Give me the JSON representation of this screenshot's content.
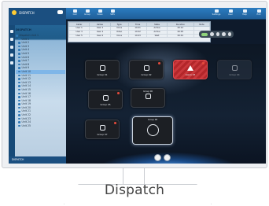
{
  "caption": "Dispatch",
  "app": {
    "title": "DISPATCH",
    "tree_title": "DISPATCH",
    "footer": "DISPATCH"
  },
  "tree_items": [
    {
      "label": "Dispatch Unit 1",
      "selected": false,
      "indent": false
    },
    {
      "label": "Unit 1",
      "selected": false,
      "indent": true
    },
    {
      "label": "Unit 2",
      "selected": false,
      "indent": true
    },
    {
      "label": "Unit 3",
      "selected": false,
      "indent": true
    },
    {
      "label": "Unit 4",
      "selected": false,
      "indent": true
    },
    {
      "label": "Unit 5",
      "selected": false,
      "indent": true
    },
    {
      "label": "Unit 6",
      "selected": false,
      "indent": true
    },
    {
      "label": "Unit 7",
      "selected": false,
      "indent": true
    },
    {
      "label": "Unit 8",
      "selected": false,
      "indent": true
    },
    {
      "label": "Unit 9",
      "selected": false,
      "indent": true
    },
    {
      "label": "Unit 10",
      "selected": true,
      "indent": true
    },
    {
      "label": "Unit 11",
      "selected": false,
      "indent": true
    },
    {
      "label": "Unit 12",
      "selected": false,
      "indent": true
    },
    {
      "label": "Unit 13",
      "selected": false,
      "indent": true
    },
    {
      "label": "Unit 14",
      "selected": false,
      "indent": true
    },
    {
      "label": "Unit 15",
      "selected": false,
      "indent": true
    },
    {
      "label": "Unit 16",
      "selected": false,
      "indent": true
    },
    {
      "label": "Unit 17",
      "selected": false,
      "indent": true
    },
    {
      "label": "Unit 18",
      "selected": false,
      "indent": true
    },
    {
      "label": "Unit 19",
      "selected": false,
      "indent": true
    },
    {
      "label": "Unit 20",
      "selected": false,
      "indent": true
    },
    {
      "label": "Unit 21",
      "selected": false,
      "indent": true
    },
    {
      "label": "Unit 22",
      "selected": false,
      "indent": true
    },
    {
      "label": "Unit 23",
      "selected": false,
      "indent": true
    },
    {
      "label": "Unit 24",
      "selected": false,
      "indent": true
    },
    {
      "label": "Unit 25",
      "selected": false,
      "indent": true
    }
  ],
  "toolbar": {
    "left": [
      {
        "icon": "phone-icon",
        "label": "Call"
      },
      {
        "icon": "group-icon",
        "label": "Group"
      },
      {
        "icon": "video-icon",
        "label": "Video"
      },
      {
        "icon": "message-icon",
        "label": "SMS"
      }
    ],
    "right": [
      {
        "icon": "settings-icon",
        "label": "Settings"
      },
      {
        "icon": "user-icon",
        "label": "User"
      },
      {
        "icon": "help-icon",
        "label": "Help"
      },
      {
        "icon": "exit-icon",
        "label": "Exit"
      }
    ]
  },
  "grid": {
    "headers": [
      "Caller",
      "Callee",
      "Type",
      "Time",
      "State",
      "Duration",
      "Note"
    ],
    "rows": [
      [
        "User 1",
        "User 2",
        "Voice",
        "10:21",
        "Active",
        "00:12",
        ""
      ],
      [
        "User 3",
        "User 4",
        "Video",
        "10:22",
        "Active",
        "00:05",
        ""
      ],
      [
        "User 5",
        "User 6",
        "Voice",
        "10:23",
        "Wait",
        "00:01",
        ""
      ]
    ]
  },
  "tiles": [
    {
      "id": "t1",
      "caption": "Group 01",
      "variant": "normal",
      "icon": "speaker-icon",
      "badge": false,
      "top": ""
    },
    {
      "id": "t2",
      "caption": "Group 02",
      "variant": "normal",
      "icon": "radio-icon",
      "badge": true,
      "top": ""
    },
    {
      "id": "t3",
      "caption": "Alarm 03",
      "variant": "alert",
      "icon": "warning-icon",
      "badge": true,
      "top": ""
    },
    {
      "id": "t4",
      "caption": "Group 04",
      "variant": "dim",
      "icon": "speaker-icon",
      "badge": false,
      "top": ""
    },
    {
      "id": "t5",
      "caption": "Group 05",
      "variant": "normal",
      "icon": "speaker-icon",
      "badge": true,
      "top": ""
    },
    {
      "id": "t6",
      "caption": "",
      "variant": "normal",
      "icon": "clock-icon",
      "badge": false,
      "top": "Group 06"
    },
    {
      "id": "t7",
      "caption": "Group 07",
      "variant": "normal",
      "icon": "speaker-icon",
      "badge": true,
      "top": ""
    },
    {
      "id": "t8",
      "caption": "",
      "variant": "big",
      "icon": "target-icon",
      "badge": false,
      "top": "Group 08"
    }
  ],
  "colors": {
    "toolbar": "#1f5f99",
    "alert": "#c9383c",
    "screen_bg": "#0e1a2b"
  }
}
